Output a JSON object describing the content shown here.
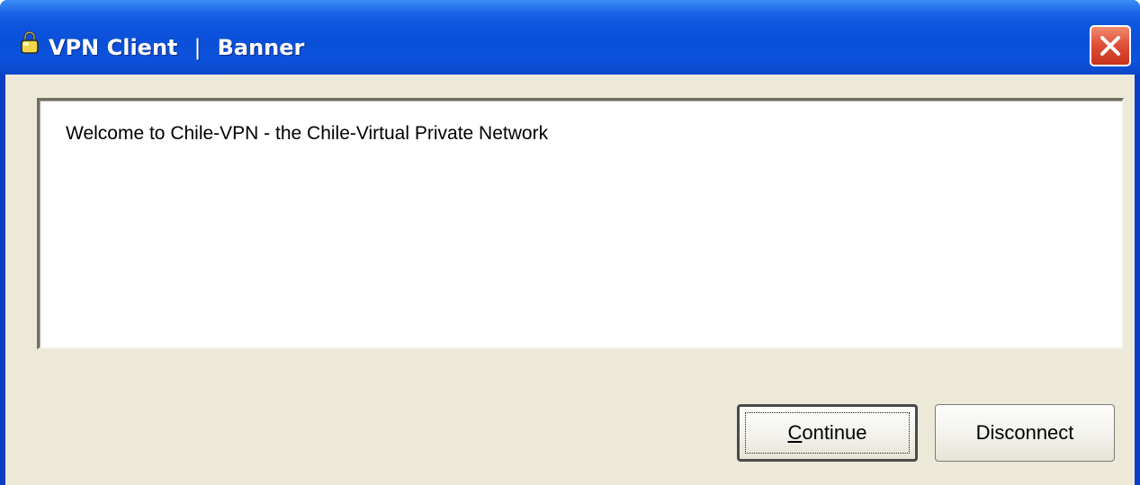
{
  "window": {
    "app_name": "VPN Client",
    "separator": "|",
    "section": "Banner"
  },
  "icons": {
    "app": "lock-icon",
    "close": "close-icon"
  },
  "banner": {
    "message": "Welcome to Chile-VPN - the Chile-Virtual Private Network"
  },
  "buttons": {
    "continue_mnemonic": "C",
    "continue_rest": "ontinue",
    "disconnect_label": "Disconnect"
  },
  "colors": {
    "titlebar": "#0a4fd8",
    "client_bg": "#ece9d8",
    "close_red": "#e0523a"
  }
}
